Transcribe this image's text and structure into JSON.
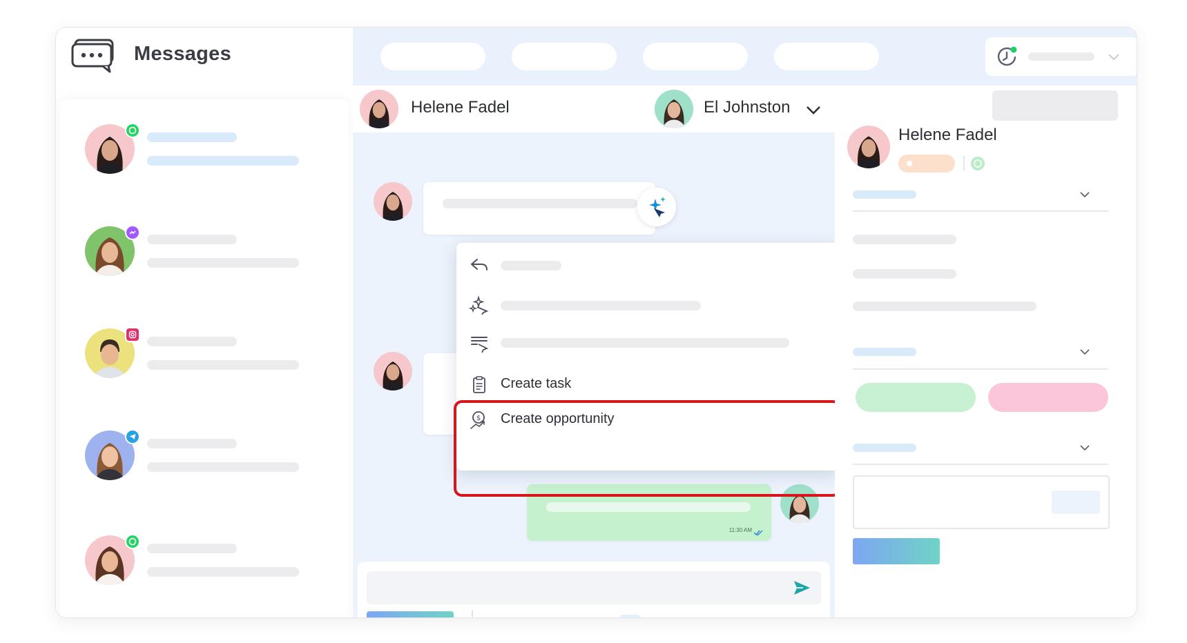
{
  "app": {
    "title": "Messages",
    "icon": "chat-bubble-icon"
  },
  "contacts": [
    {
      "channel": "whatsapp",
      "channel_icon": "whatsapp-icon",
      "badge_color": "#25d366",
      "avatar_bg": "#f6c7cb"
    },
    {
      "channel": "messenger",
      "channel_icon": "messenger-icon",
      "badge_color": "#a259ff",
      "avatar_bg": "#7fc46a"
    },
    {
      "channel": "instagram",
      "channel_icon": "instagram-icon",
      "badge_color": "#e1306c",
      "avatar_bg": "#ece27d"
    },
    {
      "channel": "telegram",
      "channel_icon": "telegram-icon",
      "badge_color": "#2aa1e3",
      "avatar_bg": "#9fb2f0"
    },
    {
      "channel": "whatsapp",
      "channel_icon": "whatsapp-icon",
      "badge_color": "#25d366",
      "avatar_bg": "#f6c7cb"
    }
  ],
  "conversation": {
    "contact_name": "Helene Fadel",
    "assignee_name": "El Johnston",
    "assignee_icon": "chevron-down-icon"
  },
  "messages": {
    "sent_time": "11:30 AM",
    "read_icon": "double-check-icon"
  },
  "context_menu": {
    "items": [
      {
        "icon": "reply-icon",
        "label": ""
      },
      {
        "icon": "ai-sparkle-icon",
        "label": ""
      },
      {
        "icon": "summary-icon",
        "label": ""
      },
      {
        "icon": "clipboard-icon",
        "label": "Create task"
      },
      {
        "icon": "opportunity-icon",
        "label": "Create opportunity"
      }
    ],
    "highlight_color": "#d6161b"
  },
  "composer": {
    "send_icon": "send-icon",
    "tools": [
      "microphone-icon",
      "image-icon",
      "attachment-icon",
      "comment-icon",
      "emoji-icon",
      "note-icon"
    ]
  },
  "profile": {
    "name": "Helene Fadel",
    "channel_icon": "whatsapp-icon"
  },
  "colors": {
    "accent_blue": "#e9f1fc",
    "sent_bubble": "#c6f1cf",
    "send_icon": "#1aa6a6",
    "tag_green": "#c8f0d3",
    "tag_pink": "#fcc6da",
    "tag_orange": "#fde0cc"
  }
}
